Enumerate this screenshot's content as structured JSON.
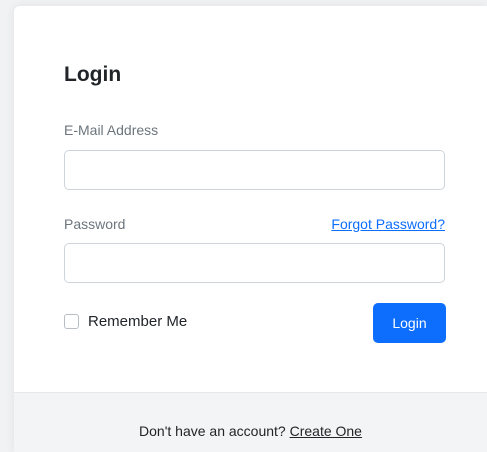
{
  "login": {
    "title": "Login",
    "email_label": "E-Mail Address",
    "email_value": "",
    "password_label": "Password",
    "password_value": "",
    "forgot_password_link": "Forgot Password?",
    "remember_me_label": "Remember Me",
    "remember_me_checked": false,
    "login_button": "Login"
  },
  "footer": {
    "prompt_text": "Don't have an account?",
    "create_link": "Create One"
  },
  "colors": {
    "primary": "#0d6efd",
    "footer_bg": "#f3f4f5"
  }
}
